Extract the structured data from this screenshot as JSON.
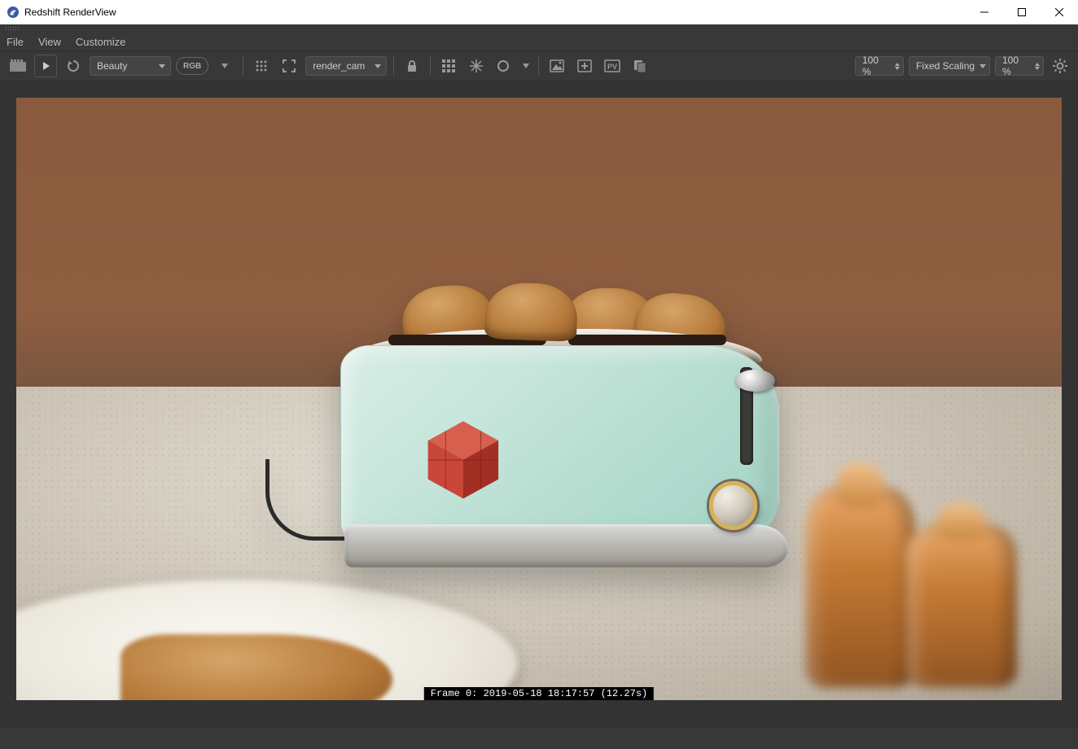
{
  "window": {
    "title": "Redshift RenderView",
    "controls": {
      "min": "minimize",
      "max": "maximize",
      "close": "close"
    }
  },
  "menubar": {
    "items": [
      "File",
      "View",
      "Customize"
    ]
  },
  "toolbar": {
    "ipr": "ipr",
    "play": "play",
    "refresh": "refresh",
    "aov_select": {
      "value": "Beauty"
    },
    "rgb": "RGB",
    "dots_tool": "channels",
    "region": "region",
    "camera_select": {
      "value": "render_cam"
    },
    "lock": "lock",
    "bucket": "bucket-grid",
    "snowflake": "freeze",
    "circle": "pick",
    "snapshot": "snapshot",
    "add_snapshot": "add-snapshot",
    "pv": "PV",
    "copy": "copy",
    "zoom_left": "100 %",
    "scaling_select": {
      "value": "Fixed Scaling"
    },
    "zoom_right": "100 %",
    "settings": "settings"
  },
  "render": {
    "frame_info": "Frame 0: 2019-05-18 18:17:57 (12.27s)"
  }
}
